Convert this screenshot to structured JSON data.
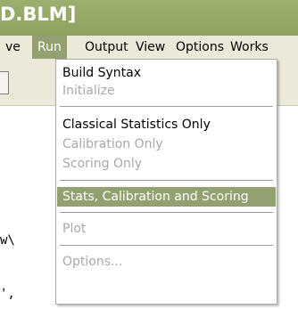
{
  "window": {
    "title_fragment": "D.BLM]"
  },
  "menubar": {
    "items": [
      "ve",
      "Run",
      "Output",
      "View",
      "Options",
      "Works"
    ],
    "active": "Run"
  },
  "editor": {
    "fragment_1": "w\\",
    "fragment_2": "',",
    "fragment_3": ""
  },
  "run_menu": {
    "build_syntax": "Build Syntax",
    "initialize": "Initialize",
    "classical_only": "Classical Statistics Only",
    "calibration_only": "Calibration Only",
    "scoring_only": "Scoring Only",
    "stats_calibration_scoring": "Stats, Calibration and Scoring",
    "plot": "Plot",
    "options": "Options..."
  },
  "colors": {
    "title_bar": "#9caf6f",
    "highlight": "#93a070",
    "menu_bg": "#ece9d8"
  }
}
